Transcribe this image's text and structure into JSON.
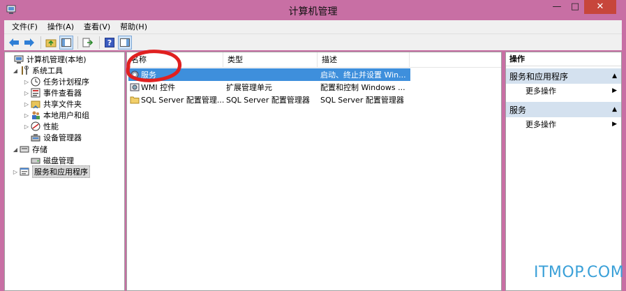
{
  "window": {
    "title": "计算机管理",
    "controls": {
      "minimize": "—",
      "maximize": "□",
      "close": "✕"
    }
  },
  "menu": [
    "文件(F)",
    "操作(A)",
    "查看(V)",
    "帮助(H)"
  ],
  "toolbar": [
    "back-arrow-icon",
    "forward-arrow-icon",
    "up-folder-icon",
    "show-hide-tree-icon",
    "export-list-icon",
    "help-icon",
    "properties-icon"
  ],
  "tree": {
    "items": [
      {
        "label": "计算机管理(本地)",
        "icon": "computer-mgmt-icon",
        "expander": ""
      },
      {
        "label": "系统工具",
        "icon": "tools-icon",
        "expander": "◢"
      },
      {
        "label": "任务计划程序",
        "icon": "clock-icon",
        "expander": "▷"
      },
      {
        "label": "事件查看器",
        "icon": "event-viewer-icon",
        "expander": "▷"
      },
      {
        "label": "共享文件夹",
        "icon": "shared-folder-icon",
        "expander": "▷"
      },
      {
        "label": "本地用户和组",
        "icon": "users-icon",
        "expander": "▷"
      },
      {
        "label": "性能",
        "icon": "performance-icon",
        "expander": "▷"
      },
      {
        "label": "设备管理器",
        "icon": "device-manager-icon",
        "expander": ""
      },
      {
        "label": "存储",
        "icon": "storage-icon",
        "expander": "◢"
      },
      {
        "label": "磁盘管理",
        "icon": "disk-icon",
        "expander": ""
      },
      {
        "label": "服务和应用程序",
        "icon": "services-apps-icon",
        "expander": "▷"
      }
    ]
  },
  "list": {
    "columns": [
      "名称",
      "类型",
      "描述"
    ],
    "rows": [
      {
        "name": "服务",
        "type": "",
        "desc": "启动、终止并设置 Win...",
        "icon": "gear-icon"
      },
      {
        "name": "WMI 控件",
        "type": "扩展管理单元",
        "desc": "配置和控制 Windows ...",
        "icon": "wmi-icon"
      },
      {
        "name": "SQL Server 配置管理...",
        "type": "SQL Server 配置管理器",
        "desc": "SQL Server 配置管理器",
        "icon": "folder-icon"
      }
    ]
  },
  "actions": {
    "title": "操作",
    "sections": [
      {
        "label": "服务和应用程序",
        "item": "更多操作"
      },
      {
        "label": "服务",
        "item": "更多操作"
      }
    ]
  },
  "watermark": "ITMOP.COM",
  "colors": {
    "titlebar": "#c86fa4",
    "selection": "#3e8fdc",
    "close": "#c7463b",
    "annotation": "#e02020",
    "action_header": "#d4e1ef"
  }
}
